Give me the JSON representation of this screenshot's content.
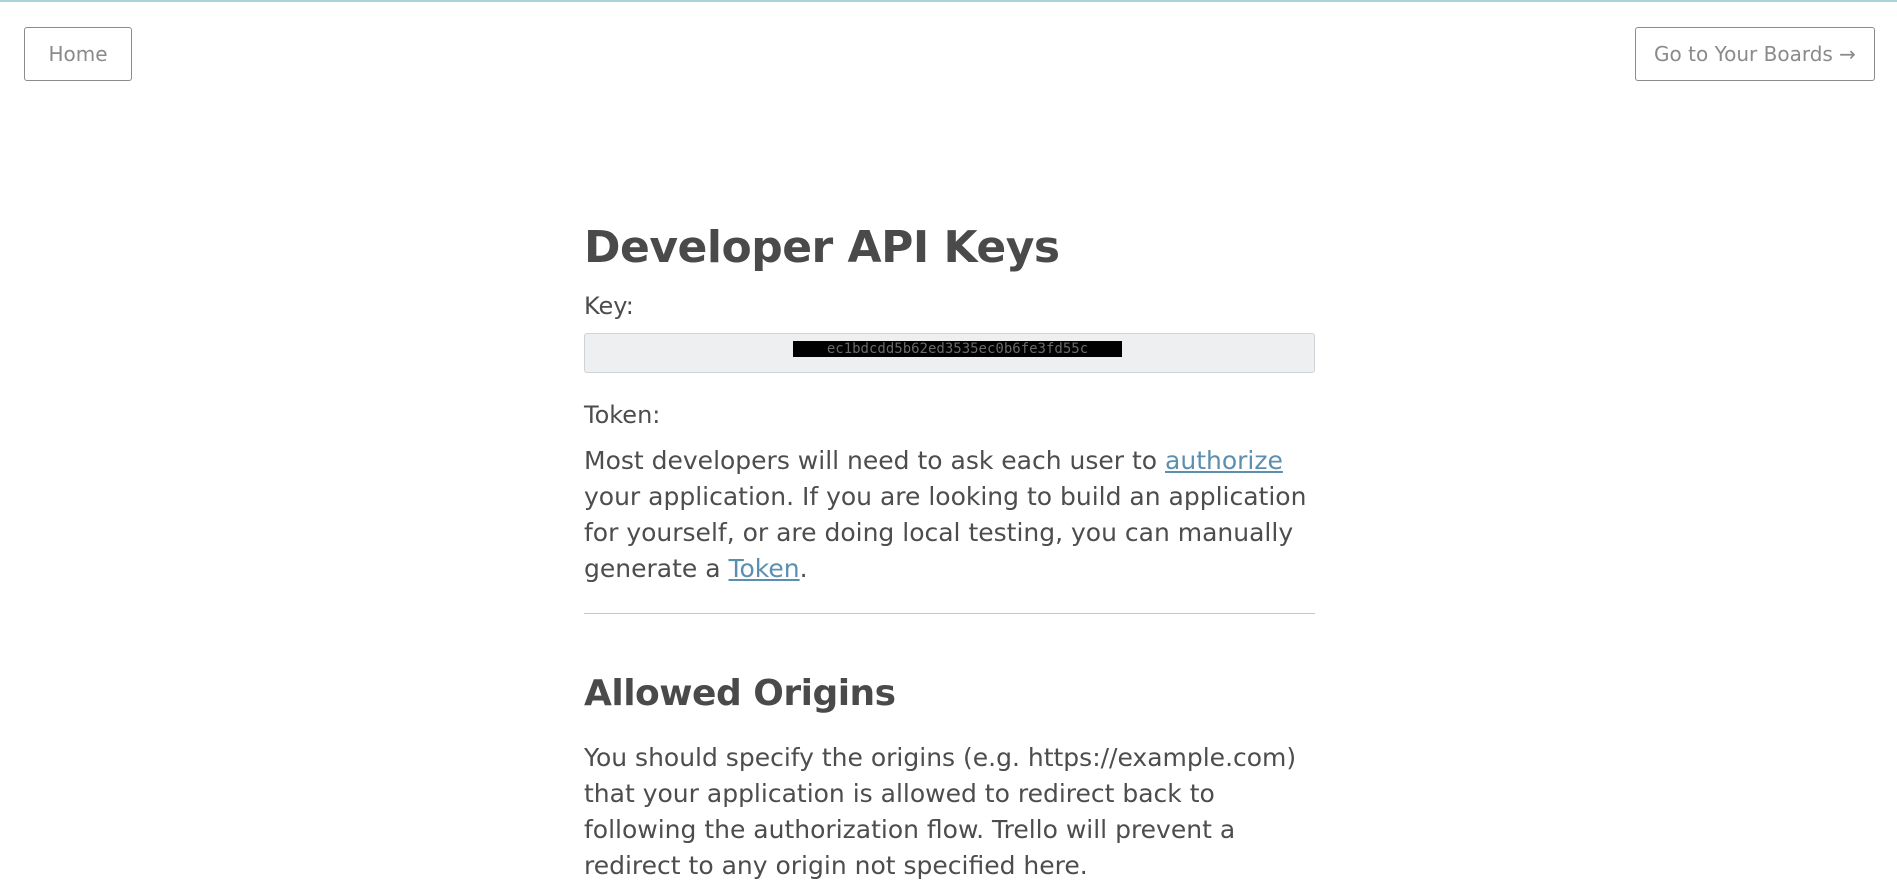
{
  "header": {
    "home_label": "Home",
    "boards_label": "Go to Your Boards →"
  },
  "main": {
    "title": "Developer API Keys",
    "key_label": "Key:",
    "key_value": "ec1bdcdd5b62ed3535ec0b6fe3fd55c",
    "token_label": "Token:",
    "token_text_1": "Most developers will need to ask each user to ",
    "authorize_link": "authorize",
    "token_text_2": " your application. If you are looking to build an application for yourself, or are doing local testing, you can manually generate a ",
    "token_link": "Token",
    "token_text_3": ".",
    "origins_title": "Allowed Origins",
    "origins_text": "You should specify the origins (e.g. https://example.com) that your application is allowed to redirect back to following the authorization flow. Trello will prevent a redirect to any origin not specified here."
  },
  "colors": {
    "link": "#5b8fb0",
    "text": "#4d4d4d",
    "top_accent": "#a9d3d6"
  }
}
